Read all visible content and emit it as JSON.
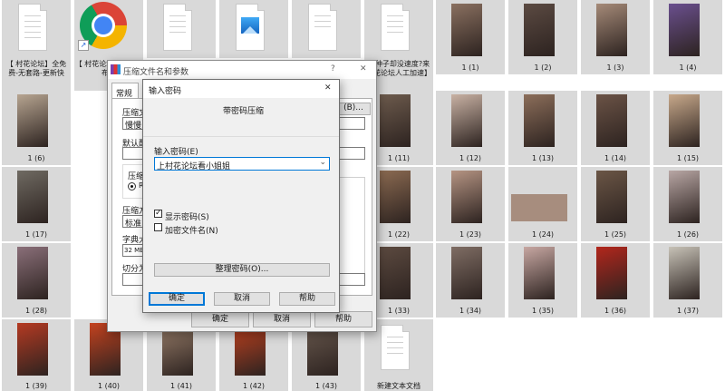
{
  "explorer": {
    "docs": [
      {
        "caption": "【 村花论坛】全免费-无套路-更新快"
      },
      {
        "caption": "【 村花论坛】地址发布页"
      },
      {
        "caption": ""
      },
      {
        "caption": ""
      },
      {
        "caption": ""
      },
      {
        "caption": "有种子却没速度?来村花论坛人工加速】"
      }
    ],
    "chrome_caption": "【 村花论坛】地址发布页",
    "thumbs": [
      {
        "caption": "1 (1)"
      },
      {
        "caption": "1 (2)"
      },
      {
        "caption": "1 (3)"
      },
      {
        "caption": "1 (4)"
      },
      {
        "caption": "1 (6)"
      },
      {
        "caption": "1 (11)"
      },
      {
        "caption": "1 (12)"
      },
      {
        "caption": "1 (13)"
      },
      {
        "caption": "1 (14)"
      },
      {
        "caption": "1 (15)"
      },
      {
        "caption": "1 (17)"
      },
      {
        "caption": "1 (22)"
      },
      {
        "caption": "1 (23)"
      },
      {
        "caption": "1 (24)"
      },
      {
        "caption": "1 (25)"
      },
      {
        "caption": "1 (26)"
      },
      {
        "caption": "1 (28)"
      },
      {
        "caption": "1 (33)"
      },
      {
        "caption": "1 (34)"
      },
      {
        "caption": "1 (35)"
      },
      {
        "caption": "1 (36)"
      },
      {
        "caption": "1 (37)"
      },
      {
        "caption": "1 (39)"
      },
      {
        "caption": "1 (40)"
      },
      {
        "caption": "1 (41)"
      },
      {
        "caption": "1 (42)"
      },
      {
        "caption": "1 (43)"
      },
      {
        "caption": "新建文本文档"
      }
    ],
    "partial_labels": [
      "1",
      "1",
      "1",
      "1",
      "1",
      "此"
    ]
  },
  "archive_dialog": {
    "title": "压缩文件名和参数",
    "help_glyph": "?",
    "close_glyph": "✕",
    "tab_general": "常规",
    "label_archive_name": "压缩文",
    "archive_name_value": "慢慢.r",
    "browse_label": "(B)...",
    "label_default": "默认配",
    "label_format": "压缩",
    "format_option": "RA",
    "label_method": "压缩方",
    "method_value": "标准",
    "label_dict": "字典大",
    "dict_value": "32 MB",
    "label_split": "切分为",
    "ok_label": "确定",
    "cancel_label": "取消",
    "help_label": "帮助"
  },
  "password_dialog": {
    "title": "输入密码",
    "close_glyph": "✕",
    "heading": "带密码压缩",
    "label_enter": "输入密码(E)",
    "password_value": "上村花论坛看小姐姐",
    "show_password_label": "显示密码(S)",
    "show_password_checked": true,
    "encrypt_names_label": "加密文件名(N)",
    "encrypt_names_checked": false,
    "organize_label": "整理密码(O)...",
    "ok_label": "确定",
    "cancel_label": "取消",
    "help_label": "帮助"
  }
}
